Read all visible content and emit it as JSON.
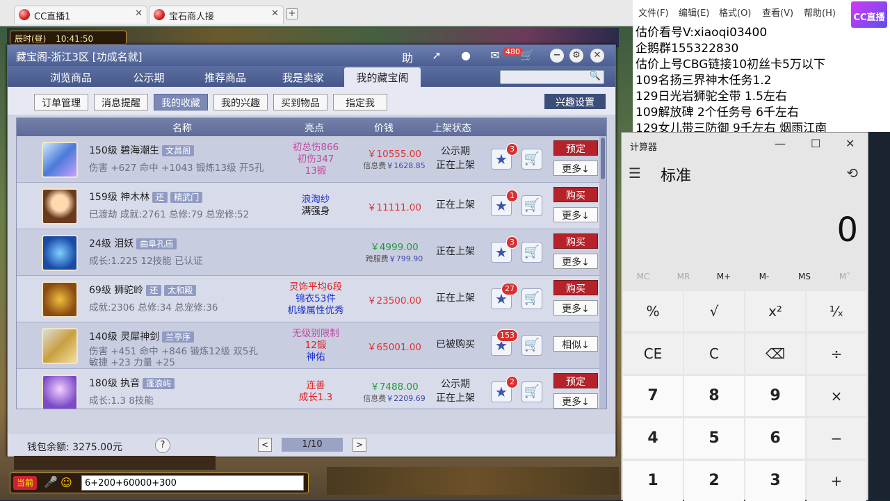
{
  "browser": {
    "tabs": [
      {
        "label": "CC直播1"
      },
      {
        "label": "宝石商人接"
      }
    ],
    "new_tab": "+"
  },
  "game": {
    "time_label": "辰时(昼)",
    "clock": "10:41:50"
  },
  "dialog": {
    "title": "藏宝阁-浙江3区 [功成名就]",
    "help_label": "助",
    "message_count": "480",
    "nav_tabs": [
      {
        "label": "浏览商品"
      },
      {
        "label": "公示期"
      },
      {
        "label": "推荐商品"
      },
      {
        "label": "我是卖家"
      },
      {
        "label": "我的藏宝阁",
        "active": true
      }
    ],
    "sub_tabs": [
      {
        "label": "订单管理"
      },
      {
        "label": "消息提醒"
      },
      {
        "label": "我的收藏",
        "active": true
      },
      {
        "label": "我的兴趣"
      },
      {
        "label": "买到物品"
      },
      {
        "label": "指定我"
      }
    ],
    "interest_button": "兴趣设置",
    "columns": [
      "名称",
      "亮点",
      "价钱",
      "上架状态"
    ],
    "rows": [
      {
        "title": "150级  碧海潮生",
        "tag": "文昌阁",
        "detail": "伤害 +627 命中 +1043 锻炼13级 开5孔",
        "highlights": [
          {
            "text": "初总伤866",
            "color": "#c04aa0"
          },
          {
            "text": "初伤347",
            "color": "#c04aa0"
          },
          {
            "text": "13锻",
            "color": "#c04aa0"
          }
        ],
        "price": "￥10555.00",
        "fee_label": "信息费",
        "fee": "￥1628.85",
        "status": [
          "公示期",
          "正在上架"
        ],
        "stars": "3",
        "action": "预定",
        "more": "更多↓"
      },
      {
        "title": "159级  神木林",
        "tag2": "还",
        "tag": "精武门",
        "detail": "已渡劫 成就:2761 总修:79 总宠修:52",
        "highlights": [
          {
            "text": "浪淘纱",
            "color": "#1a2fd0"
          },
          {
            "text": "满强身",
            "color": "#111"
          }
        ],
        "price": "￥11111.00",
        "status": [
          "正在上架"
        ],
        "stars": "1",
        "action": "购买",
        "more": "更多↓"
      },
      {
        "title": "24级  泪妖",
        "tag": "曲阜孔庙",
        "detail": "成长:1.225 12技能 已认证",
        "highlights": [],
        "price": "￥4999.00",
        "price_color": "#1c9a3a",
        "fee_label": "跨服费",
        "fee": "￥799.90",
        "status": [
          "正在上架"
        ],
        "stars": "3",
        "action": "购买",
        "more": "更多↓"
      },
      {
        "title": "69级  狮驼岭",
        "tag2": "还",
        "tag": "太和殿",
        "detail": "成就:2306 总修:34 总宠修:36",
        "highlights": [
          {
            "text": "灵饰平均6段",
            "color": "#e02020"
          },
          {
            "text": "锦衣53件",
            "color": "#1a2fd0"
          },
          {
            "text": "机缘属性优秀",
            "color": "#1a2fd0"
          }
        ],
        "price": "￥23500.00",
        "status": [
          "正在上架"
        ],
        "stars": "27",
        "action": "购买",
        "more": "更多↓"
      },
      {
        "title": "140级  灵犀神剑",
        "tag": "兰亭序",
        "detail": "伤害 +451 命中 +846 锻炼12级 双5孔",
        "detail2": "敏捷 +23 力量 +25",
        "highlights": [
          {
            "text": "无级别限制",
            "color": "#c04aa0"
          },
          {
            "text": "12锻",
            "color": "#e02020"
          },
          {
            "text": "神佑",
            "color": "#1a2fd0"
          }
        ],
        "price": "￥65001.00",
        "status": [
          "已被购买"
        ],
        "stars": "153",
        "action": "",
        "more": "相似↓"
      },
      {
        "title": "180级  执音",
        "tag": "蓬浪屿",
        "detail": "成长:1.3 8技能",
        "highlights": [
          {
            "text": "连善",
            "color": "#e02020"
          },
          {
            "text": "成长1.3",
            "color": "#e02020"
          }
        ],
        "price": "￥7488.00",
        "price_color": "#1c9a3a",
        "fee_label": "信息费",
        "fee": "￥2209.69",
        "status": [
          "公示期",
          "正在上架"
        ],
        "stars": "2",
        "action": "预定",
        "more": "更多↓"
      }
    ],
    "wallet": "钱包余额: 3275.00元",
    "help": "?",
    "page": "1/10",
    "prev": "<",
    "next": ">"
  },
  "chat": {
    "channel": "当前",
    "input": "6+200+60000+300"
  },
  "notepad": {
    "menu": [
      "文件(F)",
      "编辑(E)",
      "格式(O)",
      "查看(V)",
      "帮助(H)"
    ],
    "lines": [
      "估价看号V:xiaoqi03400",
      "企鹅群155322830",
      "估价上号CBG链接10初丝卡5万以下",
      "109名扬三界神木任务1.2",
      "129日光岩狮驼全带  1.5左右",
      "109解放碑 2个任务号 6千左右",
      "129女儿带三防御 9千左右 烟雨江南"
    ],
    "logo": "CC直播"
  },
  "calculator": {
    "title": "计算器",
    "mode": "标准",
    "display": "0",
    "memory": [
      "MC",
      "MR",
      "M+",
      "M-",
      "MS",
      "M˅"
    ],
    "keys": [
      [
        "%",
        "√",
        "x²",
        "¹⁄ₓ"
      ],
      [
        "CE",
        "C",
        "⌫",
        "÷"
      ],
      [
        "7",
        "8",
        "9",
        "×"
      ],
      [
        "4",
        "5",
        "6",
        "−"
      ],
      [
        "1",
        "2",
        "3",
        "+"
      ]
    ]
  }
}
